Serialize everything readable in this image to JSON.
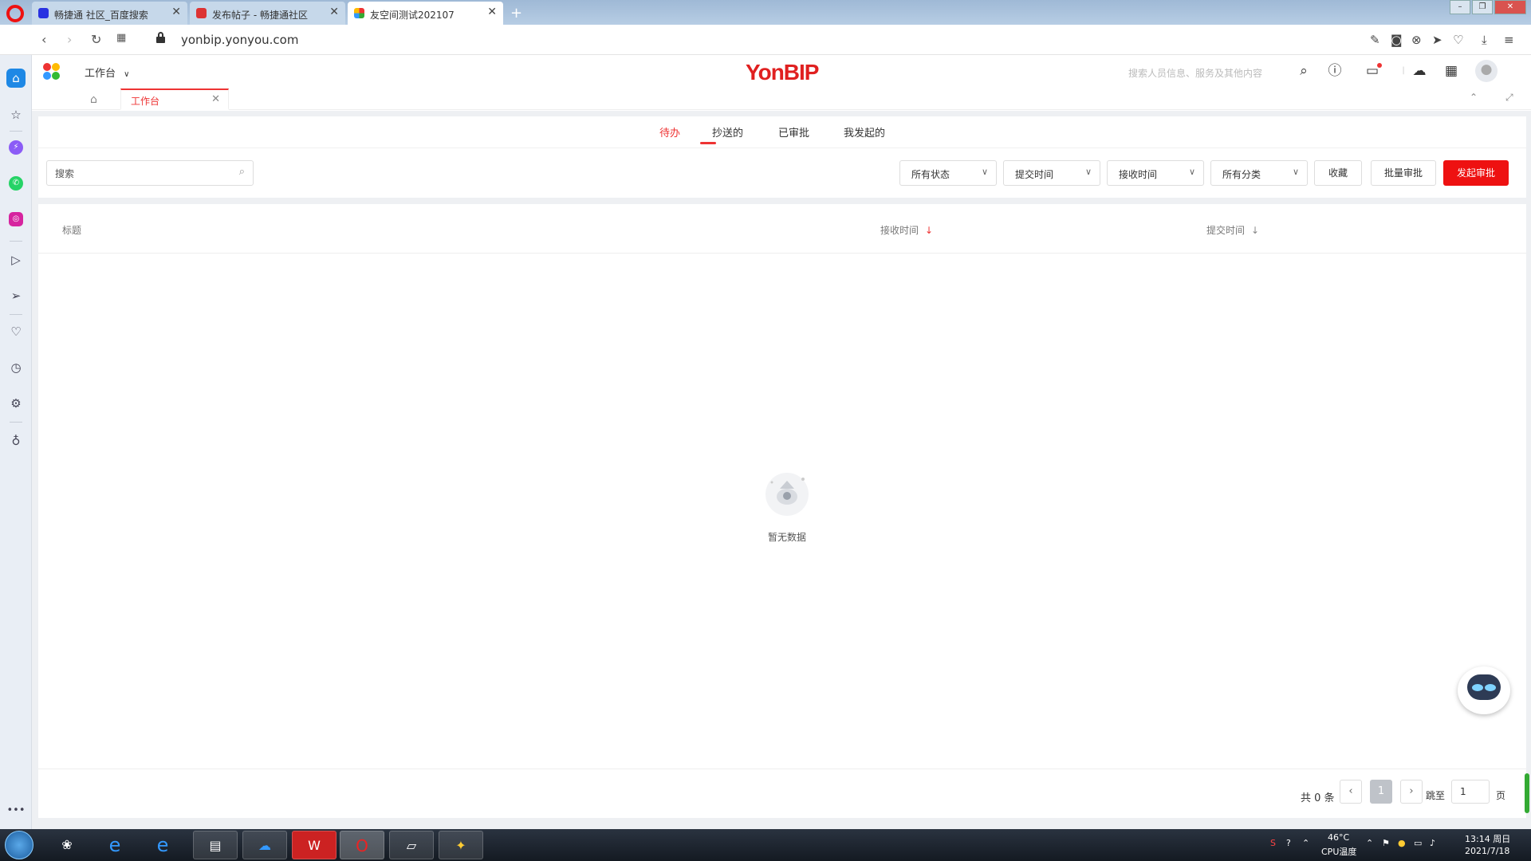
{
  "browser": {
    "tabs": [
      {
        "label": "畅捷通 社区_百度搜索",
        "active": false
      },
      {
        "label": "发布帖子 - 畅捷通社区",
        "active": false
      },
      {
        "label": "友空间测试202107",
        "active": true
      }
    ],
    "url": "yonbip.yonyou.com"
  },
  "app": {
    "workspace_label": "工作台",
    "brand": "YonBIP",
    "search_placeholder": "搜索人员信息、服务及其他内容",
    "open_tab": "工作台"
  },
  "approval": {
    "subtabs": [
      "待办",
      "抄送的",
      "已审批",
      "我发起的"
    ],
    "active_subtab": "待办",
    "search_placeholder": "搜索",
    "filters": [
      "所有状态",
      "提交时间",
      "接收时间",
      "所有分类"
    ],
    "buttons": {
      "favorite": "收藏",
      "batch": "批量审批",
      "start": "发起审批"
    },
    "columns": {
      "title": "标题",
      "received": "接收时间",
      "submitted": "提交时间"
    },
    "sort_arrow": "↓",
    "empty_text": "暂无数据"
  },
  "pager": {
    "total": "共 0 条",
    "current_page": "1",
    "jump_label": "跳至",
    "jump_value": "1",
    "page_unit": "页"
  },
  "taskbar": {
    "temperature": "46°C",
    "cpu_label": "CPU温度",
    "time": "13:14 周日",
    "date": "2021/7/18"
  },
  "colors": {
    "accent": "#e11d1d",
    "brand": "#e02020"
  }
}
